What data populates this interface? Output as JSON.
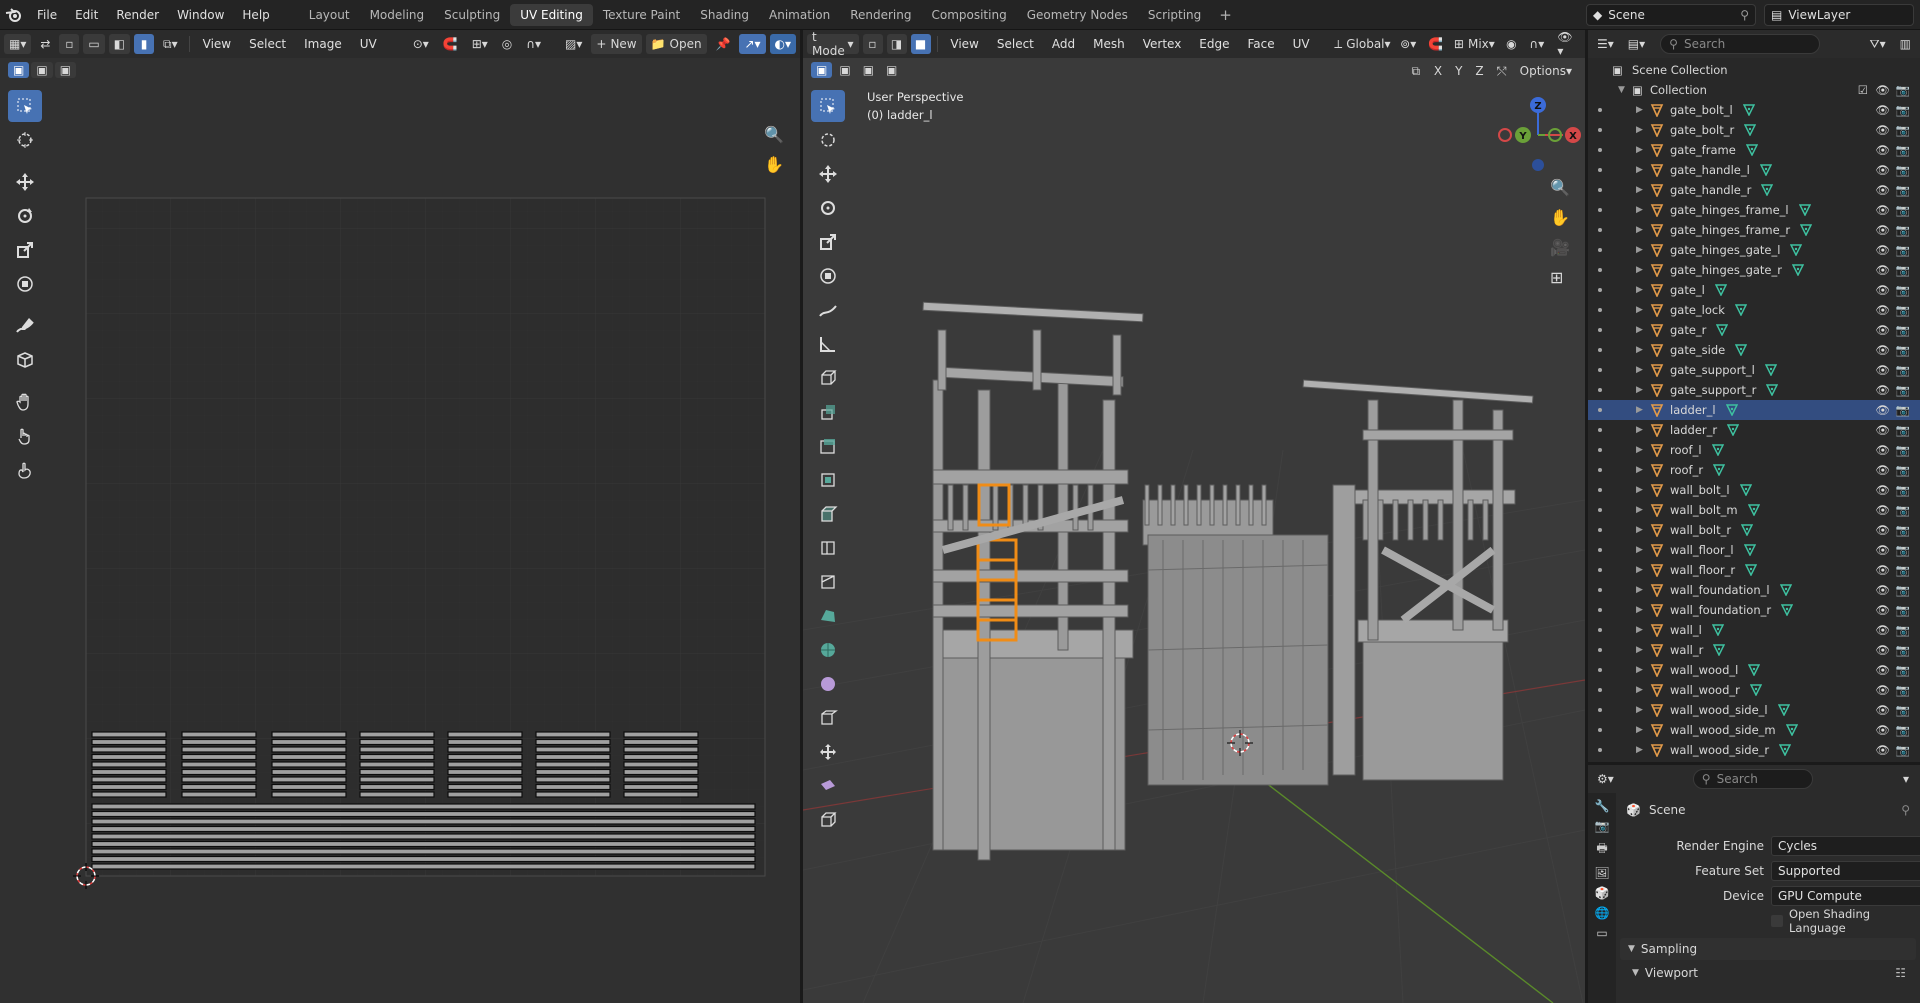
{
  "topbar": {
    "menus": [
      "File",
      "Edit",
      "Render",
      "Window",
      "Help"
    ],
    "workspaces": [
      "Layout",
      "Modeling",
      "Sculpting",
      "UV Editing",
      "Texture Paint",
      "Shading",
      "Animation",
      "Rendering",
      "Compositing",
      "Geometry Nodes",
      "Scripting"
    ],
    "active_workspace": "UV Editing",
    "add_label": "+",
    "scene": "Scene",
    "view_layer": "ViewLayer"
  },
  "uv_editor": {
    "menus": [
      "View",
      "Select",
      "Image",
      "UV"
    ],
    "new_label": "New",
    "open_label": "Open"
  },
  "viewport": {
    "mode_label": "t Mode",
    "menus": [
      "View",
      "Select",
      "Add",
      "Mesh",
      "Vertex",
      "Edge",
      "Face",
      "UV"
    ],
    "orientation": "Global",
    "mix_label": "Mix",
    "options_label": "Options",
    "axis_labels": [
      "X",
      "Y",
      "Z"
    ],
    "overlay_title": "User Perspective",
    "overlay_object": "(0) ladder_l",
    "gizmo": {
      "x": "X",
      "y": "Y",
      "z": "Z"
    }
  },
  "outliner": {
    "search_placeholder": "Search",
    "scene_collection": "Scene Collection",
    "collection": "Collection",
    "items": [
      "gate_bolt_l",
      "gate_bolt_r",
      "gate_frame",
      "gate_handle_l",
      "gate_handle_r",
      "gate_hinges_frame_l",
      "gate_hinges_frame_r",
      "gate_hinges_gate_l",
      "gate_hinges_gate_r",
      "gate_l",
      "gate_lock",
      "gate_r",
      "gate_side",
      "gate_support_l",
      "gate_support_r",
      "ladder_l",
      "ladder_r",
      "roof_l",
      "roof_r",
      "wall_bolt_l",
      "wall_bolt_m",
      "wall_bolt_r",
      "wall_floor_l",
      "wall_floor_r",
      "wall_foundation_l",
      "wall_foundation_r",
      "wall_l",
      "wall_r",
      "wall_wood_l",
      "wall_wood_r",
      "wall_wood_side_l",
      "wall_wood_side_m",
      "wall_wood_side_r"
    ],
    "selected": "ladder_l"
  },
  "properties": {
    "search_placeholder": "Search",
    "context": "Scene",
    "render_engine_label": "Render Engine",
    "render_engine": "Cycles",
    "feature_set_label": "Feature Set",
    "feature_set": "Supported",
    "device_label": "Device",
    "device": "GPU Compute",
    "osl_label": "Open Shading Language",
    "sampling_label": "Sampling",
    "viewport_label": "Viewport"
  },
  "colors": {
    "accent": "#4772b3",
    "selection": "#334d80",
    "mesh_icon": "#3ec1a0",
    "object_icon": "#e39b4a",
    "selected_object": "#f08c16"
  }
}
